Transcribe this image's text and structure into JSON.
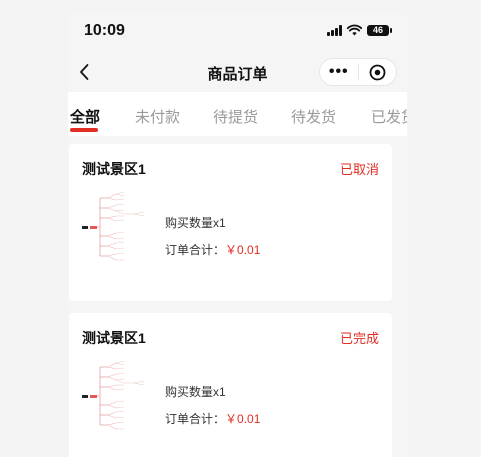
{
  "status_bar": {
    "time": "10:09",
    "battery": "46"
  },
  "nav": {
    "title": "商品订单"
  },
  "tabs": [
    {
      "label": "全部",
      "active": true
    },
    {
      "label": "未付款",
      "active": false
    },
    {
      "label": "待提货",
      "active": false
    },
    {
      "label": "待发货",
      "active": false
    },
    {
      "label": "已发货",
      "active": false
    }
  ],
  "orders": [
    {
      "scenic": "测试景区1",
      "status": "已取消",
      "quantity": "购买数量x1",
      "total_label": "订单合计：",
      "total_value": "￥0.01"
    },
    {
      "scenic": "测试景区1",
      "status": "已完成",
      "quantity": "购买数量x1",
      "total_label": "订单合计：",
      "total_value": "￥0.01"
    }
  ],
  "colors": {
    "accent": "#e02e24",
    "background": "#f5f5f5",
    "card": "#ffffff"
  },
  "icons": {
    "back": "chevron-left-icon",
    "more": "more-dots-icon",
    "close": "target-close-icon",
    "signal": "signal-icon",
    "wifi": "wifi-icon",
    "battery": "battery-icon",
    "thumbnail": "mindmap-thumbnail"
  }
}
